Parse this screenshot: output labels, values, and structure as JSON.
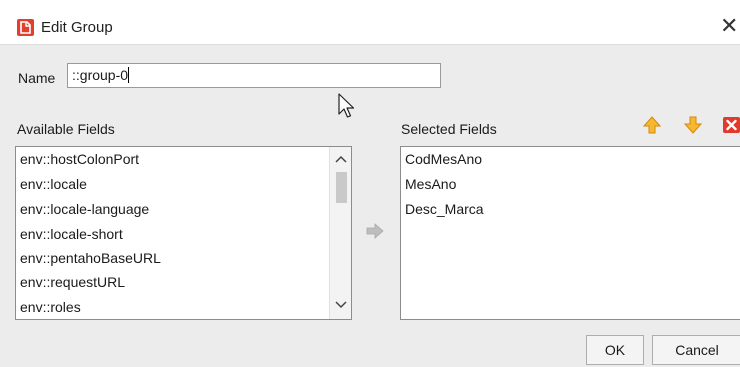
{
  "window": {
    "title": "Edit Group",
    "close_glyph": "✕",
    "app_icon": "pentaho-report-icon"
  },
  "name_field": {
    "label": "Name",
    "value": "::group-0"
  },
  "available_fields": {
    "label": "Available Fields",
    "items": [
      "env::hostColonPort",
      "env::locale",
      "env::locale-language",
      "env::locale-short",
      "env::pentahoBaseURL",
      "env::requestURL",
      "env::roles"
    ]
  },
  "selected_fields": {
    "label": "Selected Fields",
    "items": [
      "CodMesAno",
      "MesAno",
      "Desc_Marca"
    ]
  },
  "toolbar": {
    "move_up_icon": "arrow-up-icon",
    "move_down_icon": "arrow-down-icon",
    "remove_icon": "remove-icon"
  },
  "buttons": {
    "ok": "OK",
    "cancel": "Cancel"
  },
  "colors": {
    "accent_orange": "#f5a623",
    "remove_red": "#e03a2a",
    "app_icon_red": "#e2402f"
  }
}
